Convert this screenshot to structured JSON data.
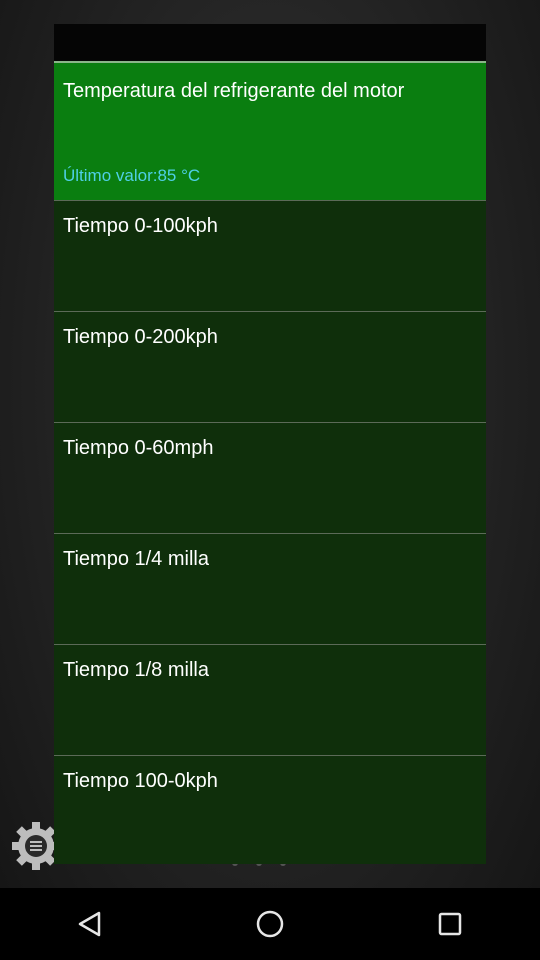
{
  "menu": {
    "items": [
      {
        "label": "Temperatura del refrigerante del motor",
        "sub": "Último valor:85 °C"
      },
      {
        "label": "Tiempo 0-100kph"
      },
      {
        "label": "Tiempo 0-200kph"
      },
      {
        "label": "Tiempo 0-60mph"
      },
      {
        "label": "Tiempo 1/4 milla"
      },
      {
        "label": "Tiempo 1/8 milla"
      },
      {
        "label": "Tiempo 100-0kph"
      }
    ]
  },
  "icons": {
    "settings": "gear-menu-icon",
    "back": "back-triangle-icon",
    "home": "home-circle-icon",
    "recents": "recents-square-icon"
  },
  "colors": {
    "selected_bg": "#0a7e10",
    "item_bg": "#0f2f0b",
    "sub_text": "#4fd0e6"
  }
}
